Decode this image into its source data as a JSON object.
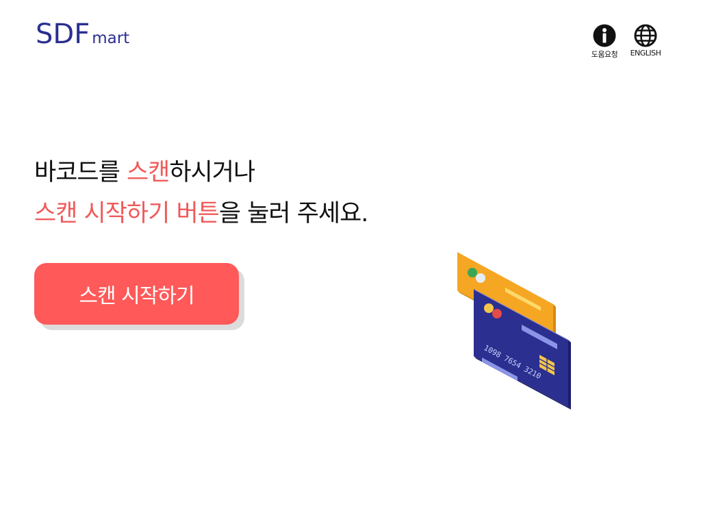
{
  "brand": {
    "name_main": "SDF",
    "name_sub": "mart",
    "color": "#2b2f8f"
  },
  "header": {
    "help": {
      "label": "도움요청",
      "icon": "info-icon"
    },
    "language": {
      "label": "ENGLISH",
      "icon": "globe-icon"
    }
  },
  "main": {
    "line1": {
      "a": "바코드를 ",
      "b": "스캔",
      "c": "하시거나"
    },
    "line2": {
      "a": "스캔 시작하기 버튼",
      "b": "을 눌러 주세요."
    },
    "accent_color": "#f05a5a",
    "scan_button_label": "스캔 시작하기",
    "card_number": "1098 7654 3210"
  }
}
